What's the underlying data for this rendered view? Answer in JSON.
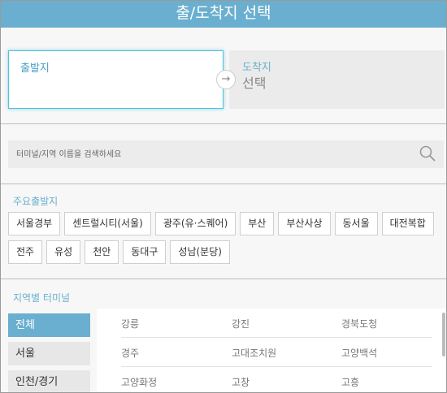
{
  "title": "출/도착지 선택",
  "departure": {
    "label": "출발지",
    "value": ""
  },
  "arrival": {
    "label": "도착지",
    "value": "선택"
  },
  "arrow_icon": "arrow-right-icon",
  "search": {
    "placeholder": "터미널/지역 이름을 검색하세요",
    "icon": "search-icon"
  },
  "major_departures": {
    "title": "주요출발지",
    "row1": [
      "서울경부",
      "센트럴시티(서울)",
      "광주(유·스퀘어)",
      "부산",
      "부산사상",
      "동서울",
      "대전복합"
    ],
    "row2": [
      "전주",
      "유성",
      "천안",
      "동대구",
      "성남(분당)"
    ]
  },
  "regional": {
    "title": "지역별 터미널",
    "regions": [
      "전체",
      "서울",
      "인천/경기"
    ],
    "active_region": "전체",
    "terminals": [
      [
        "강릉",
        "강진",
        "경북도청"
      ],
      [
        "경주",
        "고대조치원",
        "고양백석"
      ],
      [
        "고양화정",
        "고창",
        "고흥"
      ]
    ]
  },
  "colors": {
    "accent": "#6aafcf",
    "focus_border": "#4fc2df"
  }
}
